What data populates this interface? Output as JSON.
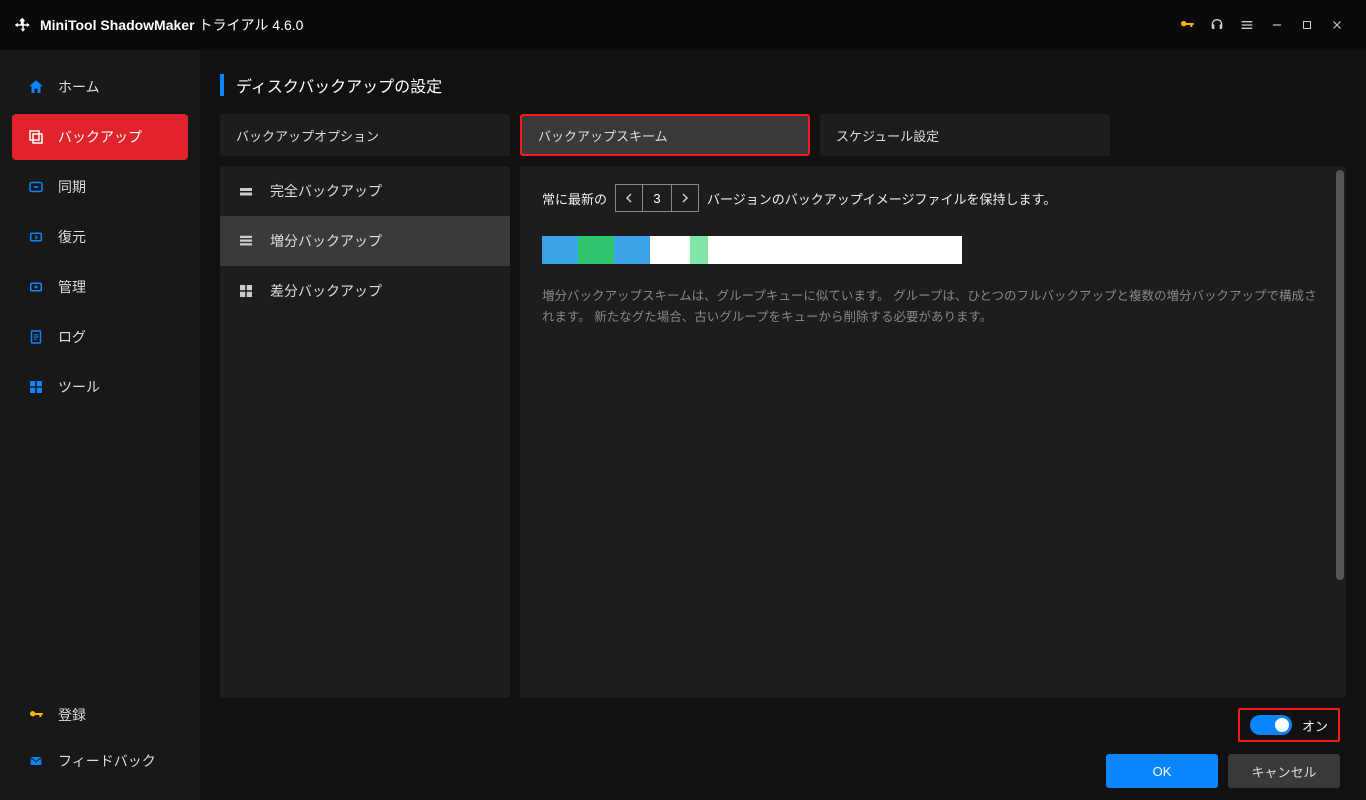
{
  "titlebar": {
    "app_name": "MiniTool ShadowMaker",
    "trial_label": "トライアル 4.6.0"
  },
  "sidebar": {
    "items": [
      {
        "label": "ホーム"
      },
      {
        "label": "バックアップ"
      },
      {
        "label": "同期"
      },
      {
        "label": "復元"
      },
      {
        "label": "管理"
      },
      {
        "label": "ログ"
      },
      {
        "label": "ツール"
      }
    ],
    "bottom": [
      {
        "label": "登録"
      },
      {
        "label": "フィードバック"
      }
    ]
  },
  "page": {
    "title": "ディスクバックアップの設定"
  },
  "tabs": [
    {
      "label": "バックアップオプション"
    },
    {
      "label": "バックアップスキーム"
    },
    {
      "label": "スケジュール設定"
    }
  ],
  "schemes": [
    {
      "label": "完全バックアップ"
    },
    {
      "label": "増分バックアップ"
    },
    {
      "label": "差分バックアップ"
    }
  ],
  "detail": {
    "prefix": "常に最新の",
    "value": "3",
    "suffix": "バージョンのバックアップイメージファイルを保持します。",
    "description": "増分バックアップスキームは、グループキューに似ています。 グループは、ひとつのフルバックアップと複数の増分バックアップで構成されます。 新たなグた場合、古いグループをキューから削除する必要があります。"
  },
  "footer": {
    "toggle_label": "オン",
    "ok": "OK",
    "cancel": "キャンセル"
  }
}
